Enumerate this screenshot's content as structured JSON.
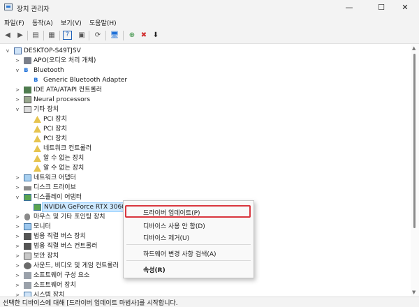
{
  "window": {
    "title": "장치 관리자",
    "minimize": "—",
    "maximize": "☐",
    "close": "✕"
  },
  "menu": [
    "파일(F)",
    "동작(A)",
    "보기(V)",
    "도움말(H)"
  ],
  "toolbar": [
    "◀",
    "▶",
    "▤",
    "▦",
    "?",
    "▣",
    "⟳",
    "🖥",
    "⊕",
    "✖",
    "⬇"
  ],
  "tree": {
    "root": "DESKTOP-S49TJSV",
    "nodes": [
      {
        "label": "APO(오디오 처리 개체)",
        "exp": ">"
      },
      {
        "label": "Bluetooth",
        "exp": "v"
      },
      {
        "label": "Generic Bluetooth Adapter",
        "exp": ""
      },
      {
        "label": "IDE ATA/ATAPI 컨트롤러",
        "exp": ">"
      },
      {
        "label": "Neural processors",
        "exp": ">"
      },
      {
        "label": "기타 장치",
        "exp": "v"
      },
      {
        "label": "PCI 장치",
        "exp": ""
      },
      {
        "label": "PCI 장치",
        "exp": ""
      },
      {
        "label": "PCI 장치",
        "exp": ""
      },
      {
        "label": "네트워크 컨트롤러",
        "exp": ""
      },
      {
        "label": "알 수 없는 장치",
        "exp": ""
      },
      {
        "label": "알 수 없는 장치",
        "exp": ""
      },
      {
        "label": "네트워크 어댑터",
        "exp": ">"
      },
      {
        "label": "디스크 드라이브",
        "exp": ">"
      },
      {
        "label": "디스플레이 어댑터",
        "exp": "v"
      },
      {
        "label": "NVIDIA GeForce RTX 3060 T",
        "exp": ""
      },
      {
        "label": "마우스 및 기타 포인팅 장치",
        "exp": ">"
      },
      {
        "label": "모니터",
        "exp": ">"
      },
      {
        "label": "범용 직렬 버스 장치",
        "exp": ">"
      },
      {
        "label": "범용 직렬 버스 컨트롤러",
        "exp": ">"
      },
      {
        "label": "보안 장치",
        "exp": ">"
      },
      {
        "label": "사운드, 비디오 및 게임 컨트롤러",
        "exp": ">"
      },
      {
        "label": "소프트웨어 구성 요소",
        "exp": ">"
      },
      {
        "label": "소프트웨어 장치",
        "exp": ">"
      },
      {
        "label": "시스템 장치",
        "exp": ">"
      }
    ]
  },
  "context_menu": {
    "update_driver": "드라이버 업데이트(P)",
    "disable": "디바이스 사용 안 함(D)",
    "uninstall": "디바이스 제거(U)",
    "scan": "하드웨어 변경 사항 검색(A)",
    "properties": "속성(R)"
  },
  "status": "선택한 디바이스에 대해 [드라이버 업데이트 마법사]를 시작합니다."
}
